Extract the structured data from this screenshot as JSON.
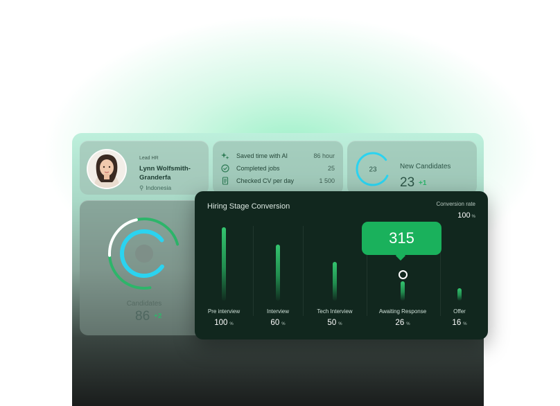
{
  "profile": {
    "role": "Lead HR",
    "name": "Lynn Wolfsmith-Granderfa",
    "location": "Indonesia"
  },
  "stats": [
    {
      "icon": "sparkle-icon",
      "label": "Saved time with AI",
      "value": "86 hour"
    },
    {
      "icon": "check-circle-icon",
      "label": "Completed jobs",
      "value": "25"
    },
    {
      "icon": "document-icon",
      "label": "Checked CV per day",
      "value": "1 500"
    }
  ],
  "new_candidates": {
    "title": "New Candidates",
    "ring_value": "23",
    "value": "23",
    "delta": "+1"
  },
  "candidates": {
    "title": "Candidates",
    "value": "86",
    "delta": "+2"
  },
  "hiring": {
    "title": "Hiring Stage Conversion",
    "conversion_label": "Conversion rate",
    "conversion_value": "100",
    "conversion_unit": "%",
    "tooltip": "315",
    "stages": [
      {
        "label": "Pre interview",
        "value": "100",
        "unit": "%",
        "bar_fraction": 1.0
      },
      {
        "label": "Interview",
        "value": "60",
        "unit": "%",
        "bar_fraction": 0.76
      },
      {
        "label": "Tech Interview",
        "value": "50",
        "unit": "%",
        "bar_fraction": 0.53
      },
      {
        "label": "Awaiting Response",
        "value": "26",
        "unit": "%",
        "bar_fraction": 0.26
      },
      {
        "label": "Offer",
        "value": "16",
        "unit": "%",
        "bar_fraction": 0.17
      }
    ]
  },
  "colors": {
    "accent_green": "#1ab15c",
    "panel_dark": "#11271e",
    "ring_cyan": "#2bd3f0"
  }
}
